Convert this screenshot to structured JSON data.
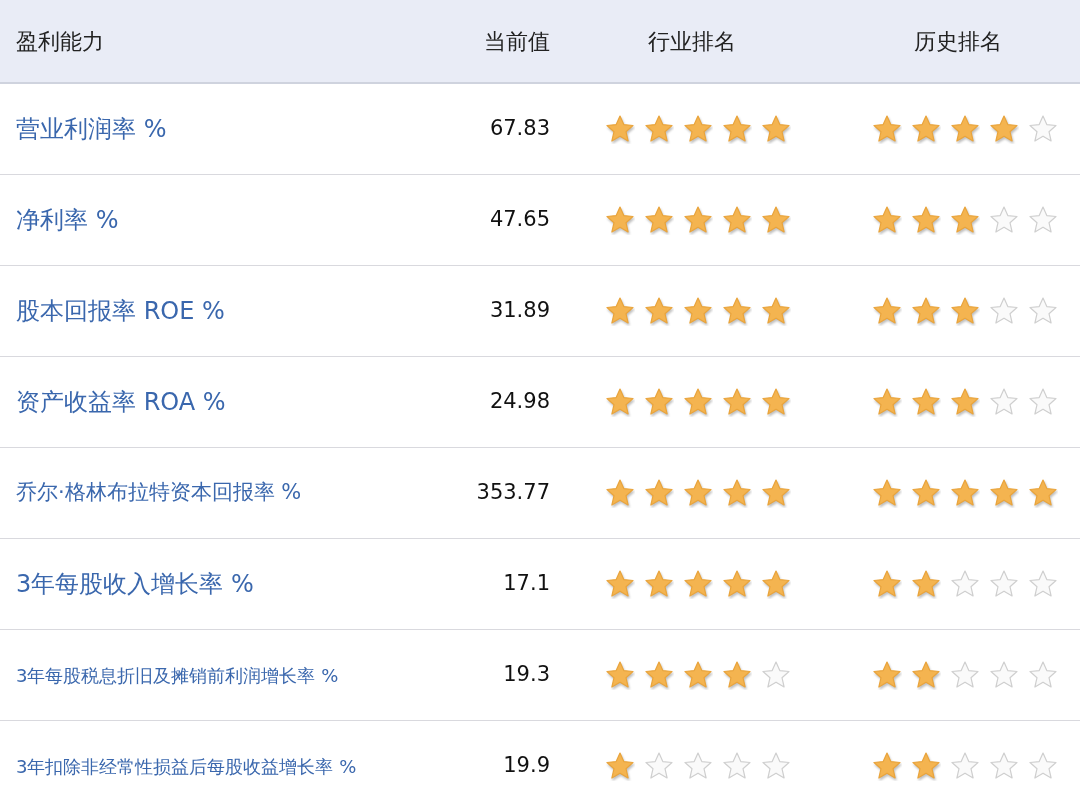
{
  "table": {
    "columns": [
      "盈利能力",
      "当前值",
      "行业排名",
      "历史排名"
    ],
    "rows": [
      {
        "label": "营业利润率 %",
        "value": "67.83",
        "industry": {
          "stars": 5
        },
        "history": {
          "stars": 4
        }
      },
      {
        "label": "净利率 %",
        "value": "47.65",
        "industry": {
          "stars": 5
        },
        "history": {
          "stars": 3
        }
      },
      {
        "label": "股本回报率 ROE %",
        "value": "31.89",
        "industry": {
          "stars": 5
        },
        "history": {
          "stars": 3
        }
      },
      {
        "label": "资产收益率 ROA %",
        "value": "24.98",
        "industry": {
          "stars": 5
        },
        "history": {
          "stars": 3
        }
      },
      {
        "label": "乔尔·格林布拉特资本回报率 %",
        "value": "353.77",
        "industry": {
          "stars": 5
        },
        "history": {
          "stars": 5
        }
      },
      {
        "label": "3年每股收入增长率 %",
        "value": "17.1",
        "industry": {
          "stars": 5
        },
        "history": {
          "stars": 2
        }
      },
      {
        "label": "3年每股税息折旧及摊销前利润增长率 %",
        "value": "19.3",
        "industry": {
          "stars": 4
        },
        "history": {
          "stars": 2
        }
      },
      {
        "label": "3年扣除非经常性损益后每股收益增长率 %",
        "value": "19.9",
        "industry": {
          "stars": 1
        },
        "history": {
          "stars": 2
        }
      }
    ]
  }
}
